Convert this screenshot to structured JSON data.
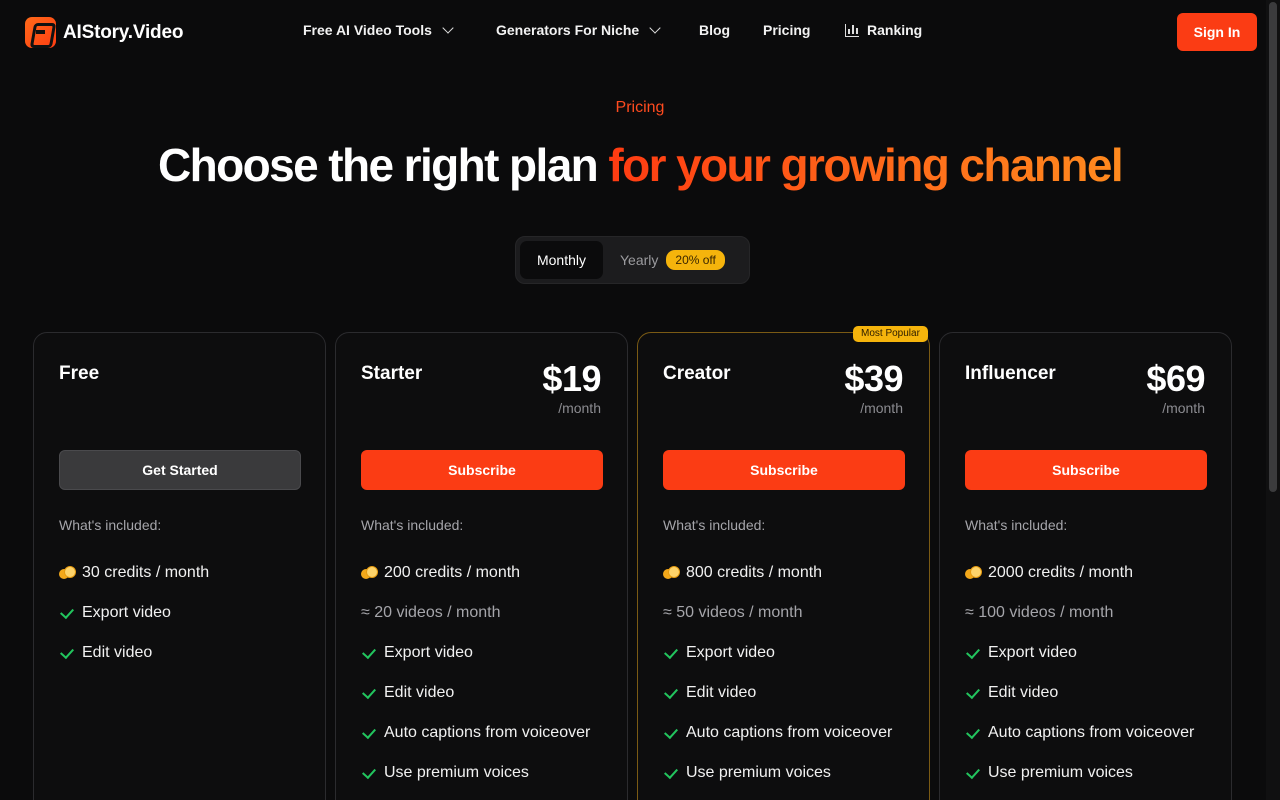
{
  "brand": {
    "name": "AIStory.Video"
  },
  "nav": {
    "items": [
      {
        "label": "Free AI Video Tools",
        "dropdown": true
      },
      {
        "label": "Generators For Niche",
        "dropdown": true
      },
      {
        "label": "Blog"
      },
      {
        "label": "Pricing"
      },
      {
        "label": "Ranking",
        "icon": "bar-chart-icon"
      }
    ],
    "signin_label": "Sign In"
  },
  "hero": {
    "eyebrow": "Pricing",
    "title_main": "Choose the right plan ",
    "title_accent": "for your growing channel"
  },
  "billing_toggle": {
    "monthly_label": "Monthly",
    "yearly_label": "Yearly",
    "discount_badge": "20% off",
    "selected": "Monthly"
  },
  "plans": [
    {
      "name": "Free",
      "price": "",
      "period": "",
      "cta": "Get Started",
      "included_label": "What's included:",
      "features": [
        "30 credits / month",
        "Export video",
        "Edit video"
      ]
    },
    {
      "name": "Starter",
      "price": "$19",
      "period": "/month",
      "cta": "Subscribe",
      "included_label": "What's included:",
      "features": [
        "200 credits / month",
        "≈ 20 videos / month",
        "Export video",
        "Edit video",
        "Auto captions from voiceover",
        "Use premium voices"
      ]
    },
    {
      "name": "Creator",
      "price": "$39",
      "period": "/month",
      "badge": "Most Popular",
      "cta": "Subscribe",
      "included_label": "What's included:",
      "features": [
        "800 credits / month",
        "≈ 50 videos / month",
        "Export video",
        "Edit video",
        "Auto captions from voiceover",
        "Use premium voices"
      ]
    },
    {
      "name": "Influencer",
      "price": "$69",
      "period": "/month",
      "cta": "Subscribe",
      "included_label": "What's included:",
      "features": [
        "2000 credits / month",
        "≈ 100 videos / month",
        "Export video",
        "Edit video",
        "Auto captions from voiceover",
        "Use premium voices"
      ]
    }
  ],
  "colors": {
    "background": "#0b0b0c",
    "accent": "#fb3c14",
    "badge": "#f5b40c",
    "check": "#22c55e"
  }
}
